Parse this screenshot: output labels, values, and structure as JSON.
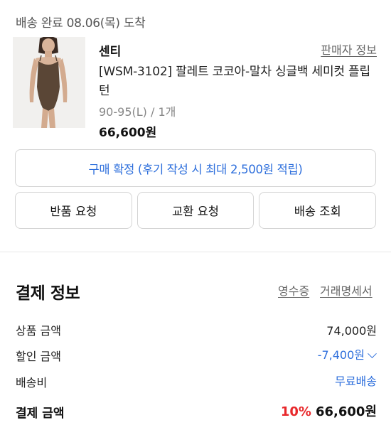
{
  "delivery": {
    "status_text": "배송 완료 08.06(목) 도착"
  },
  "product": {
    "seller": "센티",
    "seller_info_label": "판매자 정보",
    "name": "[WSM-3102] 팔레트 코코아-말차 싱글백 세미컷 플립턴",
    "option": "90-95(L) / 1개",
    "price": "66,600원",
    "thumbnail_icon": "swimsuit-product-photo"
  },
  "confirm": {
    "label": "구매 확정 (후기 작성 시 최대 2,500원 적립)"
  },
  "actions": [
    {
      "label": "반품 요청"
    },
    {
      "label": "교환 요청"
    },
    {
      "label": "배송 조회"
    }
  ],
  "payment": {
    "title": "결제 정보",
    "receipt_label": "영수증",
    "statement_label": "거래명세서",
    "rows": [
      {
        "label": "상품 금액",
        "value": "74,000원"
      },
      {
        "label": "할인 금액",
        "value": "-7,400원"
      },
      {
        "label": "배송비",
        "value": "무료배송"
      }
    ],
    "total_label": "결제 금액",
    "discount_percent": "10%",
    "total_value": "66,600원"
  },
  "colors": {
    "accent_blue": "#2e6fdc",
    "discount_red": "#e8282b"
  }
}
